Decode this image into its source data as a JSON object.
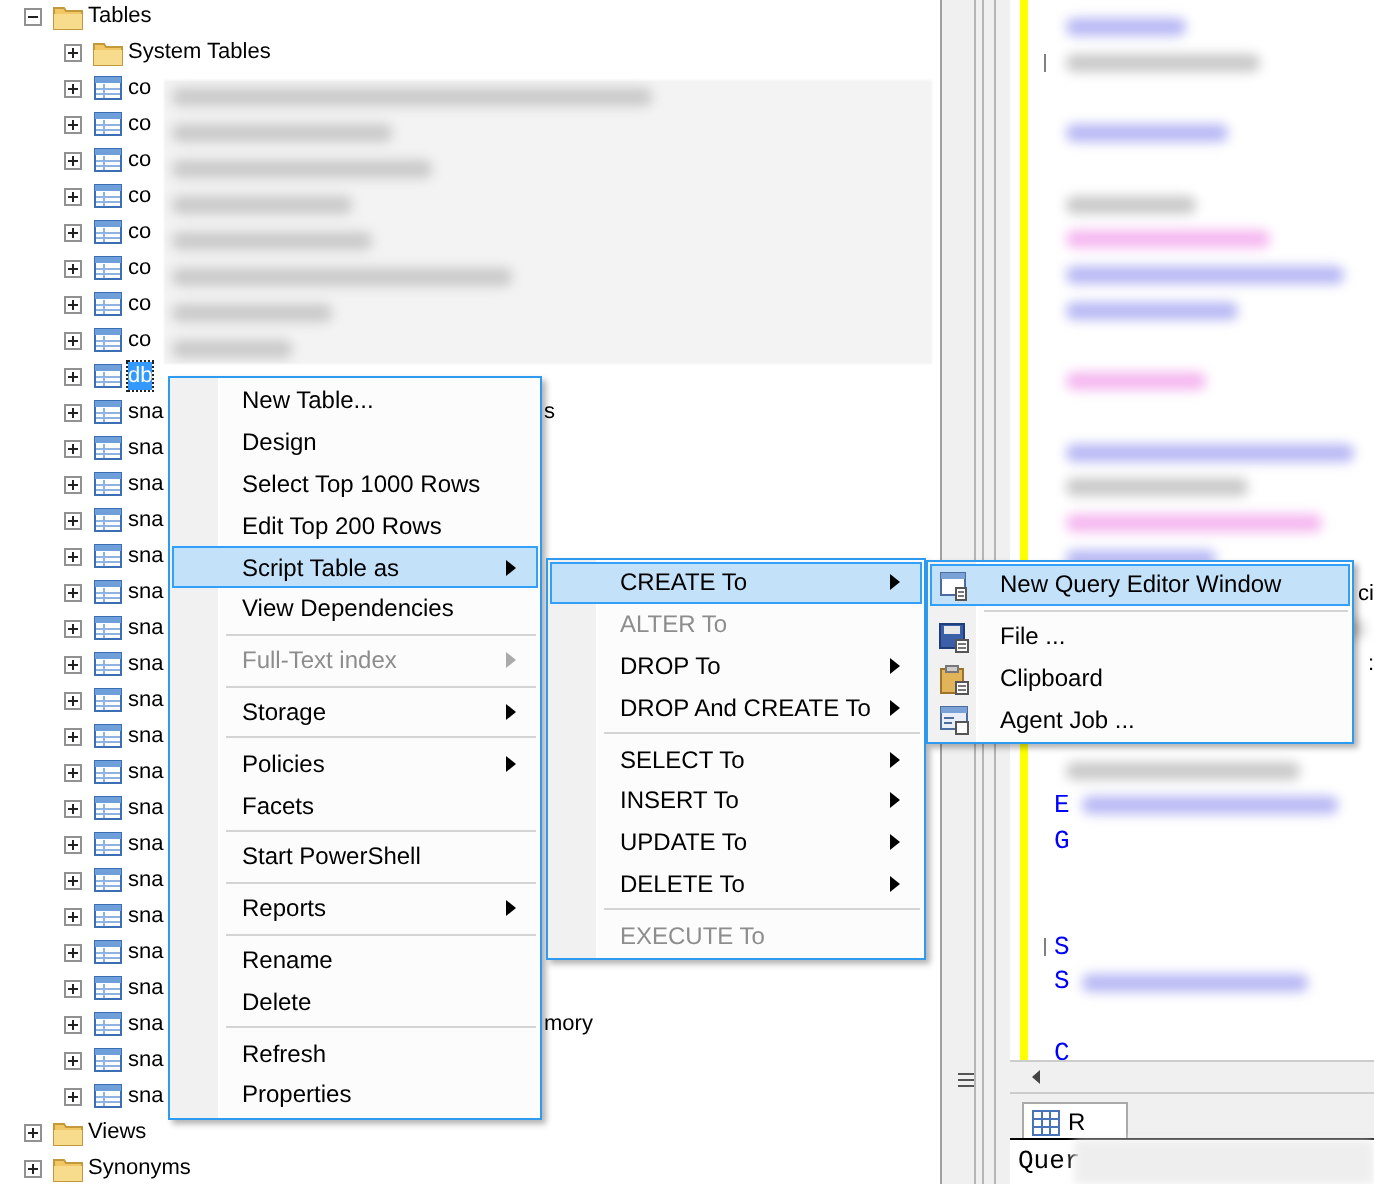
{
  "tree": {
    "items": [
      {
        "label": "Tables",
        "kind": "folder",
        "expanded": true,
        "selected": false,
        "children": [
          {
            "label": "System Tables",
            "kind": "folder",
            "expanded": false,
            "selected": false
          },
          {
            "label": "co",
            "kind": "table",
            "expanded": false,
            "selected": false
          },
          {
            "label": "co",
            "kind": "table",
            "expanded": false,
            "selected": false
          },
          {
            "label": "co",
            "kind": "table",
            "expanded": false,
            "selected": false
          },
          {
            "label": "co",
            "kind": "table",
            "expanded": false,
            "selected": false
          },
          {
            "label": "co",
            "kind": "table",
            "expanded": false,
            "selected": false
          },
          {
            "label": "co",
            "kind": "table",
            "expanded": false,
            "selected": false
          },
          {
            "label": "co",
            "kind": "table",
            "expanded": false,
            "selected": false
          },
          {
            "label": "co",
            "kind": "table",
            "expanded": false,
            "selected": false
          },
          {
            "label": "db",
            "kind": "table",
            "expanded": false,
            "selected": true
          },
          {
            "label": "sna",
            "tail": "s",
            "kind": "table",
            "expanded": false,
            "selected": false
          },
          {
            "label": "sna",
            "kind": "table",
            "expanded": false,
            "selected": false
          },
          {
            "label": "sna",
            "kind": "table",
            "expanded": false,
            "selected": false
          },
          {
            "label": "sna",
            "kind": "table",
            "expanded": false,
            "selected": false
          },
          {
            "label": "sna",
            "kind": "table",
            "expanded": false,
            "selected": false
          },
          {
            "label": "sna",
            "kind": "table",
            "expanded": false,
            "selected": false
          },
          {
            "label": "sna",
            "kind": "table",
            "expanded": false,
            "selected": false
          },
          {
            "label": "sna",
            "kind": "table",
            "expanded": false,
            "selected": false
          },
          {
            "label": "sna",
            "kind": "table",
            "expanded": false,
            "selected": false
          },
          {
            "label": "sna",
            "kind": "table",
            "expanded": false,
            "selected": false
          },
          {
            "label": "sna",
            "kind": "table",
            "expanded": false,
            "selected": false
          },
          {
            "label": "sna",
            "kind": "table",
            "expanded": false,
            "selected": false
          },
          {
            "label": "sna",
            "kind": "table",
            "expanded": false,
            "selected": false
          },
          {
            "label": "sna",
            "kind": "table",
            "expanded": false,
            "selected": false
          },
          {
            "label": "sna",
            "kind": "table",
            "expanded": false,
            "selected": false
          },
          {
            "label": "sna",
            "kind": "table",
            "expanded": false,
            "selected": false
          },
          {
            "label": "sna",
            "kind": "table",
            "expanded": false,
            "selected": false
          },
          {
            "label": "sna",
            "tail": "mory",
            "kind": "table",
            "expanded": false,
            "selected": false
          },
          {
            "label": "sna",
            "kind": "table",
            "expanded": false,
            "selected": false
          },
          {
            "label": "sna",
            "kind": "table",
            "expanded": false,
            "selected": false
          }
        ]
      },
      {
        "label": "Views",
        "kind": "folder",
        "expanded": false,
        "selected": false
      },
      {
        "label": "Synonyms",
        "kind": "folder",
        "expanded": false,
        "selected": false
      }
    ]
  },
  "menus": [
    {
      "items": [
        {
          "kind": "item",
          "label": "New Table...",
          "selected": false,
          "disabled": false,
          "submenu": false
        },
        {
          "kind": "item",
          "label": "Design",
          "selected": false,
          "disabled": false,
          "submenu": false
        },
        {
          "kind": "item",
          "label": "Select Top 1000 Rows",
          "selected": false,
          "disabled": false,
          "submenu": false
        },
        {
          "kind": "item",
          "label": "Edit Top 200 Rows",
          "selected": false,
          "disabled": false,
          "submenu": false
        },
        {
          "kind": "item",
          "label": "Script Table as",
          "selected": true,
          "disabled": false,
          "submenu": true
        },
        {
          "kind": "item",
          "label": "View Dependencies",
          "selected": false,
          "disabled": false,
          "submenu": false
        },
        {
          "kind": "separator"
        },
        {
          "kind": "item",
          "label": "Full-Text index",
          "selected": false,
          "disabled": true,
          "submenu": true
        },
        {
          "kind": "separator"
        },
        {
          "kind": "item",
          "label": "Storage",
          "selected": false,
          "disabled": false,
          "submenu": true
        },
        {
          "kind": "separator"
        },
        {
          "kind": "item",
          "label": "Policies",
          "selected": false,
          "disabled": false,
          "submenu": true
        },
        {
          "kind": "item",
          "label": "Facets",
          "selected": false,
          "disabled": false,
          "submenu": false
        },
        {
          "kind": "separator"
        },
        {
          "kind": "item",
          "label": "Start PowerShell",
          "selected": false,
          "disabled": false,
          "submenu": false
        },
        {
          "kind": "separator"
        },
        {
          "kind": "item",
          "label": "Reports",
          "selected": false,
          "disabled": false,
          "submenu": true
        },
        {
          "kind": "separator"
        },
        {
          "kind": "item",
          "label": "Rename",
          "selected": false,
          "disabled": false,
          "submenu": false
        },
        {
          "kind": "item",
          "label": "Delete",
          "selected": false,
          "disabled": false,
          "submenu": false
        },
        {
          "kind": "separator"
        },
        {
          "kind": "item",
          "label": "Refresh",
          "selected": false,
          "disabled": false,
          "submenu": false
        },
        {
          "kind": "item",
          "label": "Properties",
          "selected": false,
          "disabled": false,
          "submenu": false
        }
      ]
    },
    {
      "items": [
        {
          "kind": "item",
          "label": "CREATE To",
          "selected": true,
          "disabled": false,
          "submenu": true
        },
        {
          "kind": "item",
          "label": "ALTER To",
          "selected": false,
          "disabled": true,
          "submenu": false
        },
        {
          "kind": "item",
          "label": "DROP To",
          "selected": false,
          "disabled": false,
          "submenu": true
        },
        {
          "kind": "item",
          "label": "DROP And CREATE To",
          "selected": false,
          "disabled": false,
          "submenu": true
        },
        {
          "kind": "separator"
        },
        {
          "kind": "item",
          "label": "SELECT To",
          "selected": false,
          "disabled": false,
          "submenu": true
        },
        {
          "kind": "item",
          "label": "INSERT To",
          "selected": false,
          "disabled": false,
          "submenu": true
        },
        {
          "kind": "item",
          "label": "UPDATE To",
          "selected": false,
          "disabled": false,
          "submenu": true
        },
        {
          "kind": "item",
          "label": "DELETE To",
          "selected": false,
          "disabled": false,
          "submenu": true
        },
        {
          "kind": "separator"
        },
        {
          "kind": "item",
          "label": "EXECUTE To",
          "selected": false,
          "disabled": true,
          "submenu": false
        }
      ]
    },
    {
      "items": [
        {
          "kind": "item",
          "label": "New Query Editor Window",
          "selected": true,
          "disabled": false,
          "submenu": false
        },
        {
          "kind": "separator"
        },
        {
          "kind": "item",
          "label": "File ...",
          "selected": false,
          "disabled": false,
          "submenu": false
        },
        {
          "kind": "item",
          "label": "Clipboard",
          "selected": false,
          "disabled": false,
          "submenu": false
        },
        {
          "kind": "item",
          "label": "Agent Job ...",
          "selected": false,
          "disabled": false,
          "submenu": false
        }
      ]
    }
  ],
  "editor": {
    "lines": [
      {
        "kind": "blurred"
      },
      {
        "kind": "blurred",
        "fold": true
      },
      {
        "kind": "blank"
      },
      {
        "kind": "blurred"
      },
      {
        "kind": "blank"
      },
      {
        "kind": "blurred"
      },
      {
        "kind": "blurred"
      },
      {
        "kind": "blurred"
      },
      {
        "kind": "blurred"
      },
      {
        "kind": "blank"
      },
      {
        "kind": "blurred"
      },
      {
        "kind": "blank"
      },
      {
        "kind": "blurred"
      },
      {
        "kind": "blurred"
      },
      {
        "kind": "blurred"
      },
      {
        "kind": "blurred"
      },
      {
        "kind": "text-end",
        "text": "ci"
      },
      {
        "kind": "blurred"
      },
      {
        "kind": "text-end",
        "text": ":"
      },
      {
        "kind": "blank"
      },
      {
        "kind": "blank"
      },
      {
        "kind": "blurred"
      },
      {
        "kind": "text",
        "text": "E"
      },
      {
        "kind": "text",
        "text": "G"
      },
      {
        "kind": "blank"
      },
      {
        "kind": "blank"
      },
      {
        "kind": "text",
        "text": "S",
        "fold": true
      },
      {
        "kind": "text",
        "text": "S"
      },
      {
        "kind": "blank"
      },
      {
        "kind": "text",
        "text": "C"
      }
    ],
    "results_tab": "R",
    "results_text": "Quer"
  }
}
